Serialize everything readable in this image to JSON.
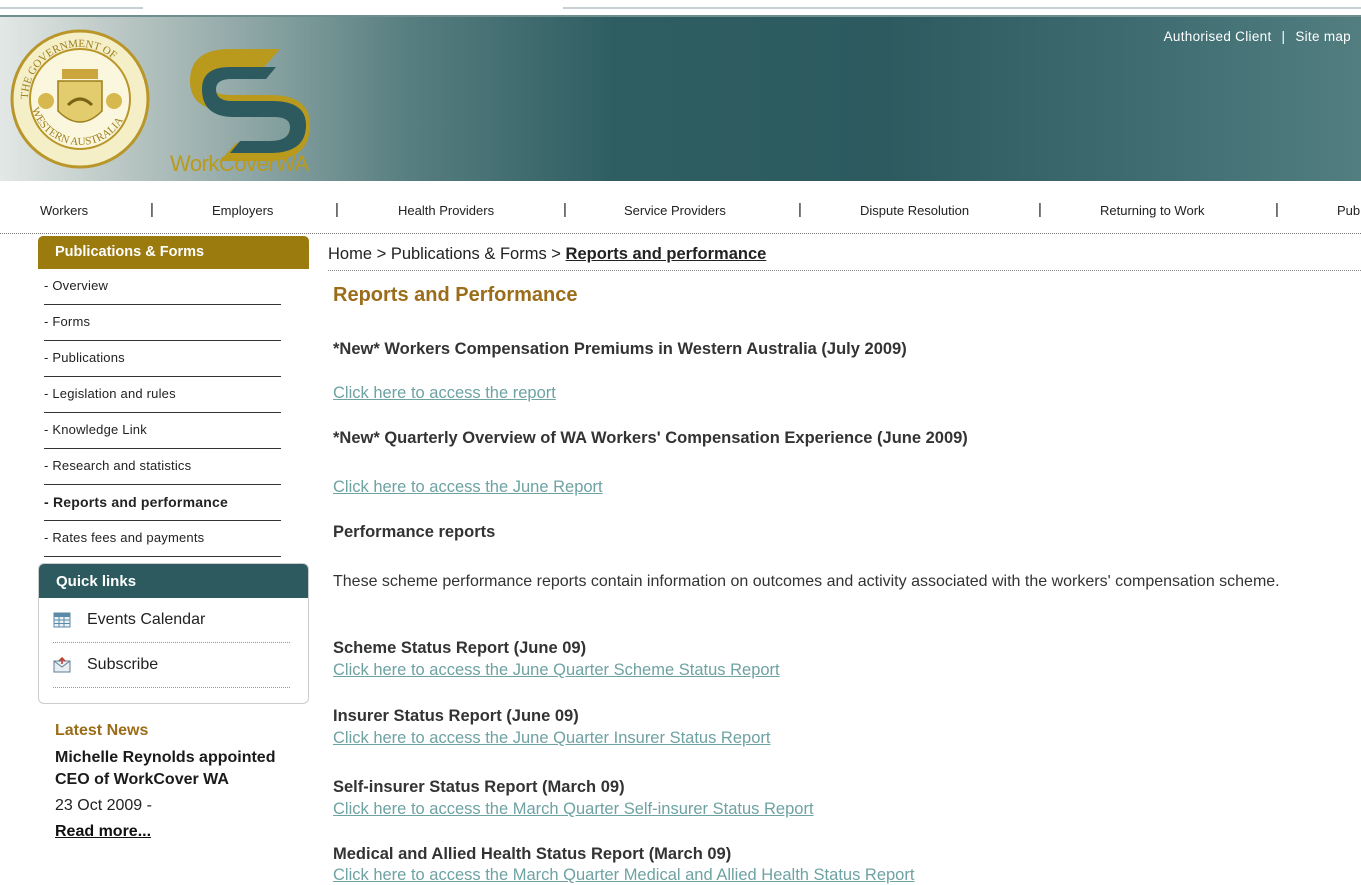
{
  "header": {
    "seal_alt": "THE GOVERNMENT OF WESTERN AUSTRALIA",
    "logo_text": "WorkCoverWA",
    "top_links": [
      "Authorised Client",
      "Site map"
    ],
    "top_sep": "|"
  },
  "nav": {
    "items": [
      "Workers",
      "Employers",
      "Health Providers",
      "Service Providers",
      "Dispute Resolution",
      "Returning to Work",
      "Pub"
    ],
    "separator": "|"
  },
  "sidebar": {
    "heading": "Publications & Forms",
    "items": [
      "- Overview",
      "- Forms",
      "- Publications",
      "- Legislation and rules",
      "- Knowledge Link",
      "- Research and statistics",
      "- Reports and performance",
      "- Rates fees and payments"
    ],
    "active_index": 6
  },
  "quick_links": {
    "heading": "Quick links",
    "items": [
      "Events Calendar",
      "Subscribe"
    ]
  },
  "news": {
    "heading": "Latest News",
    "title": "Michelle Reynolds appointed CEO of WorkCover WA",
    "date": "23 Oct 2009 -",
    "read_more": "Read more..."
  },
  "breadcrumb": {
    "home": "Home",
    "sep": " > ",
    "section": "Publications & Forms",
    "current": "Reports and performance"
  },
  "main": {
    "title": "Reports and Performance",
    "new1_heading": "*New* Workers Compensation Premiums in Western Australia (July 2009)",
    "new1_link": "Click here to access the report",
    "new2_heading": "*New* Quarterly Overview of WA Workers' Compensation Experience (June 2009)",
    "new2_link": "Click here to access the June Report",
    "perf_heading": "Performance reports",
    "perf_text": "These scheme performance reports contain information on outcomes and activity associated with the workers' compensation scheme.",
    "reports": [
      {
        "heading": "Scheme Status Report (June 09)",
        "link": "Click here to access the June Quarter Scheme Status Report"
      },
      {
        "heading": "Insurer Status Report (June 09)",
        "link": "Click here to access the June Quarter Insurer Status Report"
      },
      {
        "heading": "Self-insurer Status Report (March 09)",
        "link": "Click here to access the March Quarter Self-insurer Status Report"
      },
      {
        "heading": "Medical and Allied Health Status Report (March 09)",
        "link": "Click here to access the March Quarter Medical and Allied Health Status Report"
      }
    ]
  },
  "colors": {
    "gold": "#9b7a0e",
    "teal": "#2c5a5f",
    "link": "#6ea2a3"
  }
}
